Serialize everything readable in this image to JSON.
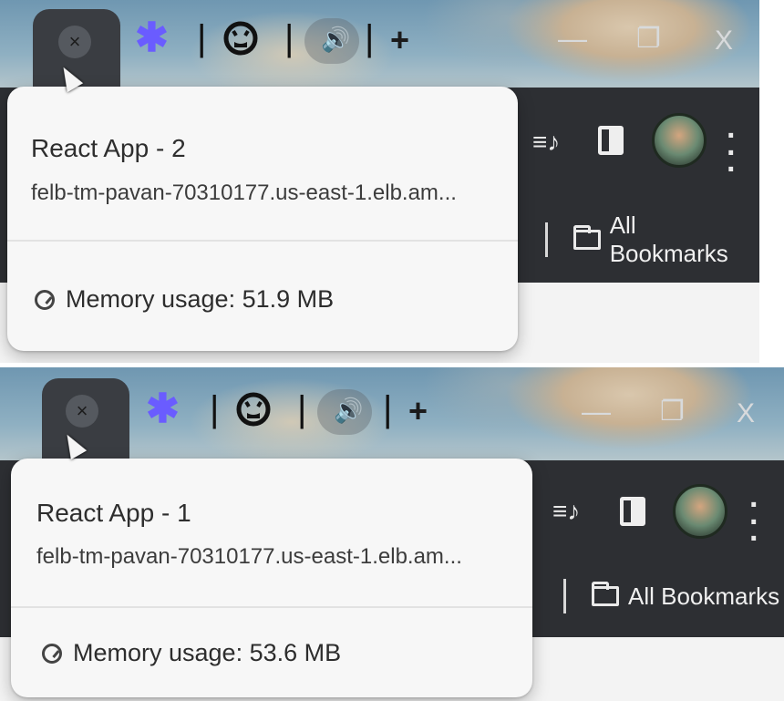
{
  "screens": [
    {
      "tab_close_glyph": "×",
      "tabstrip": {
        "pinned_icon": "asterisk-icon",
        "separator": "|",
        "github_icon": "github-icon",
        "speaker_icon": "speaker-icon",
        "new_tab_glyph": "+"
      },
      "window_controls": {
        "minimize": "—",
        "restore": "❐",
        "close": "X"
      },
      "toolbar": {
        "bookmarks_label": "All Bookmarks"
      },
      "hovercard": {
        "title": "React App - 2",
        "url": "felb-tm-pavan-70310177.us-east-1.elb.am...",
        "memory": "Memory usage: 51.9 MB"
      }
    },
    {
      "tab_close_glyph": "×",
      "tabstrip": {
        "pinned_icon": "asterisk-icon",
        "separator": "|",
        "github_icon": "github-icon",
        "speaker_icon": "speaker-icon",
        "new_tab_glyph": "+"
      },
      "window_controls": {
        "minimize": "—",
        "restore": "❐",
        "close": "X"
      },
      "toolbar": {
        "bookmarks_label": "All Bookmarks"
      },
      "hovercard": {
        "title": "React App - 1",
        "url": "felb-tm-pavan-70310177.us-east-1.elb.am...",
        "memory": "Memory usage: 53.6 MB"
      }
    }
  ],
  "colors": {
    "asterisk": "#6a5cff",
    "toolbar": "#2d2f33",
    "card": "#f7f7f7"
  }
}
